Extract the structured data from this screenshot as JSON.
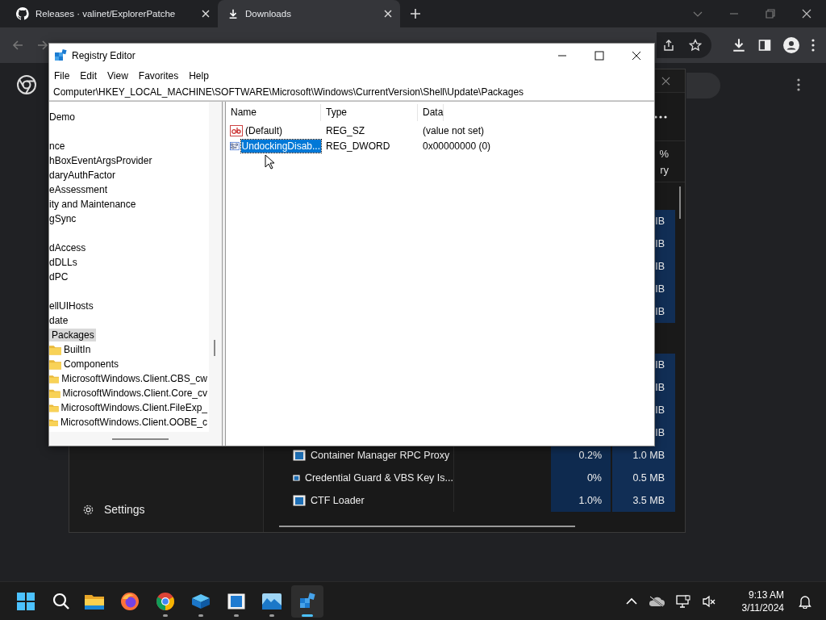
{
  "browser": {
    "tabs": [
      {
        "title": "Releases · valinet/ExplorerPatche",
        "selected": false
      },
      {
        "title": "Downloads",
        "selected": true
      }
    ]
  },
  "task_manager": {
    "header_fragments": [
      "%",
      "ry"
    ],
    "groups": [
      {
        "processes": [
          {
            "memory": "IB"
          },
          {
            "memory": "IB"
          },
          {
            "memory": "IB"
          },
          {
            "memory": "IB"
          },
          {
            "memory": "IB"
          }
        ]
      },
      {
        "processes": [
          {
            "memory": "IB"
          },
          {
            "memory": "IB"
          },
          {
            "memory": "IB"
          },
          {
            "memory": "IB"
          },
          {
            "name": "Container Manager RPC Proxy",
            "cpu": "0.2%",
            "memory": "1.0 MB"
          },
          {
            "name": "Credential Guard & VBS Key Is...",
            "cpu": "0%",
            "memory": "0.5 MB"
          },
          {
            "name": "CTF Loader",
            "cpu": "1.0%",
            "memory": "3.5 MB"
          }
        ]
      }
    ],
    "nav": [
      {
        "label": "Settings"
      }
    ]
  },
  "registry_editor": {
    "title": "Registry Editor",
    "menu": [
      "File",
      "Edit",
      "View",
      "Favorites",
      "Help"
    ],
    "address": "Computer\\HKEY_LOCAL_MACHINE\\SOFTWARE\\Microsoft\\Windows\\CurrentVersion\\Shell\\Update\\Packages",
    "tree_sections": [
      {
        "items": [
          {
            "label": "Demo",
            "selected": false
          }
        ]
      },
      {
        "items": [
          {
            "label": "nce",
            "selected": false
          },
          {
            "label": "hBoxEventArgsProvider",
            "selected": false
          },
          {
            "label": "daryAuthFactor",
            "selected": false
          },
          {
            "label": "eAssessment",
            "selected": false
          },
          {
            "label": "ity and Maintenance",
            "selected": false
          },
          {
            "label": "gSync",
            "selected": false
          }
        ]
      },
      {
        "items": [
          {
            "label": "dAccess",
            "selected": false
          },
          {
            "label": "dDLLs",
            "selected": false
          },
          {
            "label": "dPC",
            "selected": false
          }
        ]
      },
      {
        "items": [
          {
            "label": "ellUIHosts",
            "selected": false
          },
          {
            "label": "date",
            "selected": false,
            "children": [
              {
                "label": "Packages",
                "selected": true,
                "children": [
                  {
                    "label": "BuiltIn",
                    "selected": false
                  },
                  {
                    "label": "Components",
                    "selected": false
                  },
                  {
                    "label": "MicrosoftWindows.Client.CBS_cw",
                    "selected": false
                  },
                  {
                    "label": "MicrosoftWindows.Client.Core_cv",
                    "selected": false
                  },
                  {
                    "label": "MicrosoftWindows.Client.FileExp_",
                    "selected": false
                  },
                  {
                    "label": "MicrosoftWindows.Client.OOBE_c",
                    "selected": false
                  }
                ]
              }
            ]
          }
        ]
      }
    ],
    "columns": [
      "Name",
      "Type",
      "Data"
    ],
    "values": [
      {
        "name": "(Default)",
        "kind": "string",
        "type": "REG_SZ",
        "data": "(value not set)",
        "selected": false
      },
      {
        "name": "UndockingDisab...",
        "kind": "binary",
        "type": "REG_DWORD",
        "data": "0x00000000 (0)",
        "selected": true
      }
    ]
  },
  "taskbar": {
    "apps": [
      {
        "kind": "explorer",
        "running": false,
        "active": false
      },
      {
        "kind": "firefox",
        "running": false,
        "active": false
      },
      {
        "kind": "chrome",
        "running": true,
        "active": false
      },
      {
        "kind": "box",
        "running": true,
        "active": false
      },
      {
        "kind": "window",
        "running": true,
        "active": false
      },
      {
        "kind": "photos",
        "running": true,
        "active": false
      },
      {
        "kind": "regedit",
        "running": true,
        "active": true
      }
    ],
    "time": "9:13 AM",
    "date": "3/11/2024"
  }
}
